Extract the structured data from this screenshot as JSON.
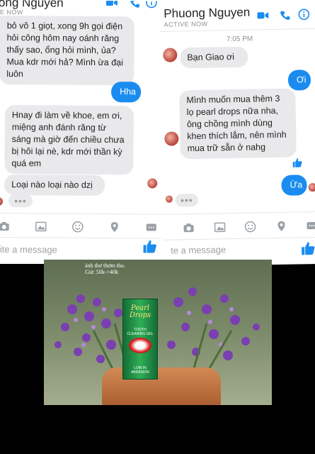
{
  "left_panel": {
    "contact_name": "ong Nguyen",
    "status": "E NOW",
    "messages": [
      {
        "from": "them",
        "text": "bỏ vô 1 giọt, xong 9h gọi điện hỏi công hôm nay oánh răng thấy sao, ổng hỏi mình, ủa? Mua kdr mới hả? Mình ừa đại luôn"
      },
      {
        "from": "me",
        "text": "Hha"
      },
      {
        "from": "them",
        "text": "Hnay đi làm về khoe, em ơi, miệng anh đánh răng từ sáng mà giờ đến chiều chưa bị hôi lại nè, kdr mới thần kỳ quá em"
      },
      {
        "from": "them",
        "text": "Loại nào loại nào dzị"
      }
    ],
    "typing": "•••",
    "input_placeholder": "rite a message"
  },
  "right_panel": {
    "contact_name": "Phuong Nguyen",
    "status": "ACTIVE NOW",
    "timestamp": "7:05 PM",
    "messages": [
      {
        "from": "them",
        "text": "Bạn Giao ơi"
      },
      {
        "from": "me",
        "text": "Ơi"
      },
      {
        "from": "them",
        "text": "Mình muốn mua thêm 3 lọ pearl drops nữa nha, ông chồng mình dùng khen thích lắm, nên mình mua trữ sẵn ở nahg"
      },
      {
        "from": "me",
        "text": "Ừa"
      }
    ],
    "typing": "•••",
    "input_placeholder": "te a message"
  },
  "product_photo": {
    "caption_line1": "ánh thơ thơm tho.",
    "caption_line2": "Giá: 50k->40k",
    "brand_line1": "Pearl",
    "brand_line2": "Drops",
    "product_label": "TOOTH CLEANING GEL",
    "product_foot": "LOW IN ABRASION"
  },
  "colors": {
    "accent": "#1a8cf0",
    "bubble_gray": "#e9e9eb"
  },
  "icons": [
    "video-call-icon",
    "phone-icon",
    "info-icon",
    "camera-icon",
    "image-icon",
    "emoji-icon",
    "location-icon",
    "more-icon",
    "like-icon"
  ]
}
